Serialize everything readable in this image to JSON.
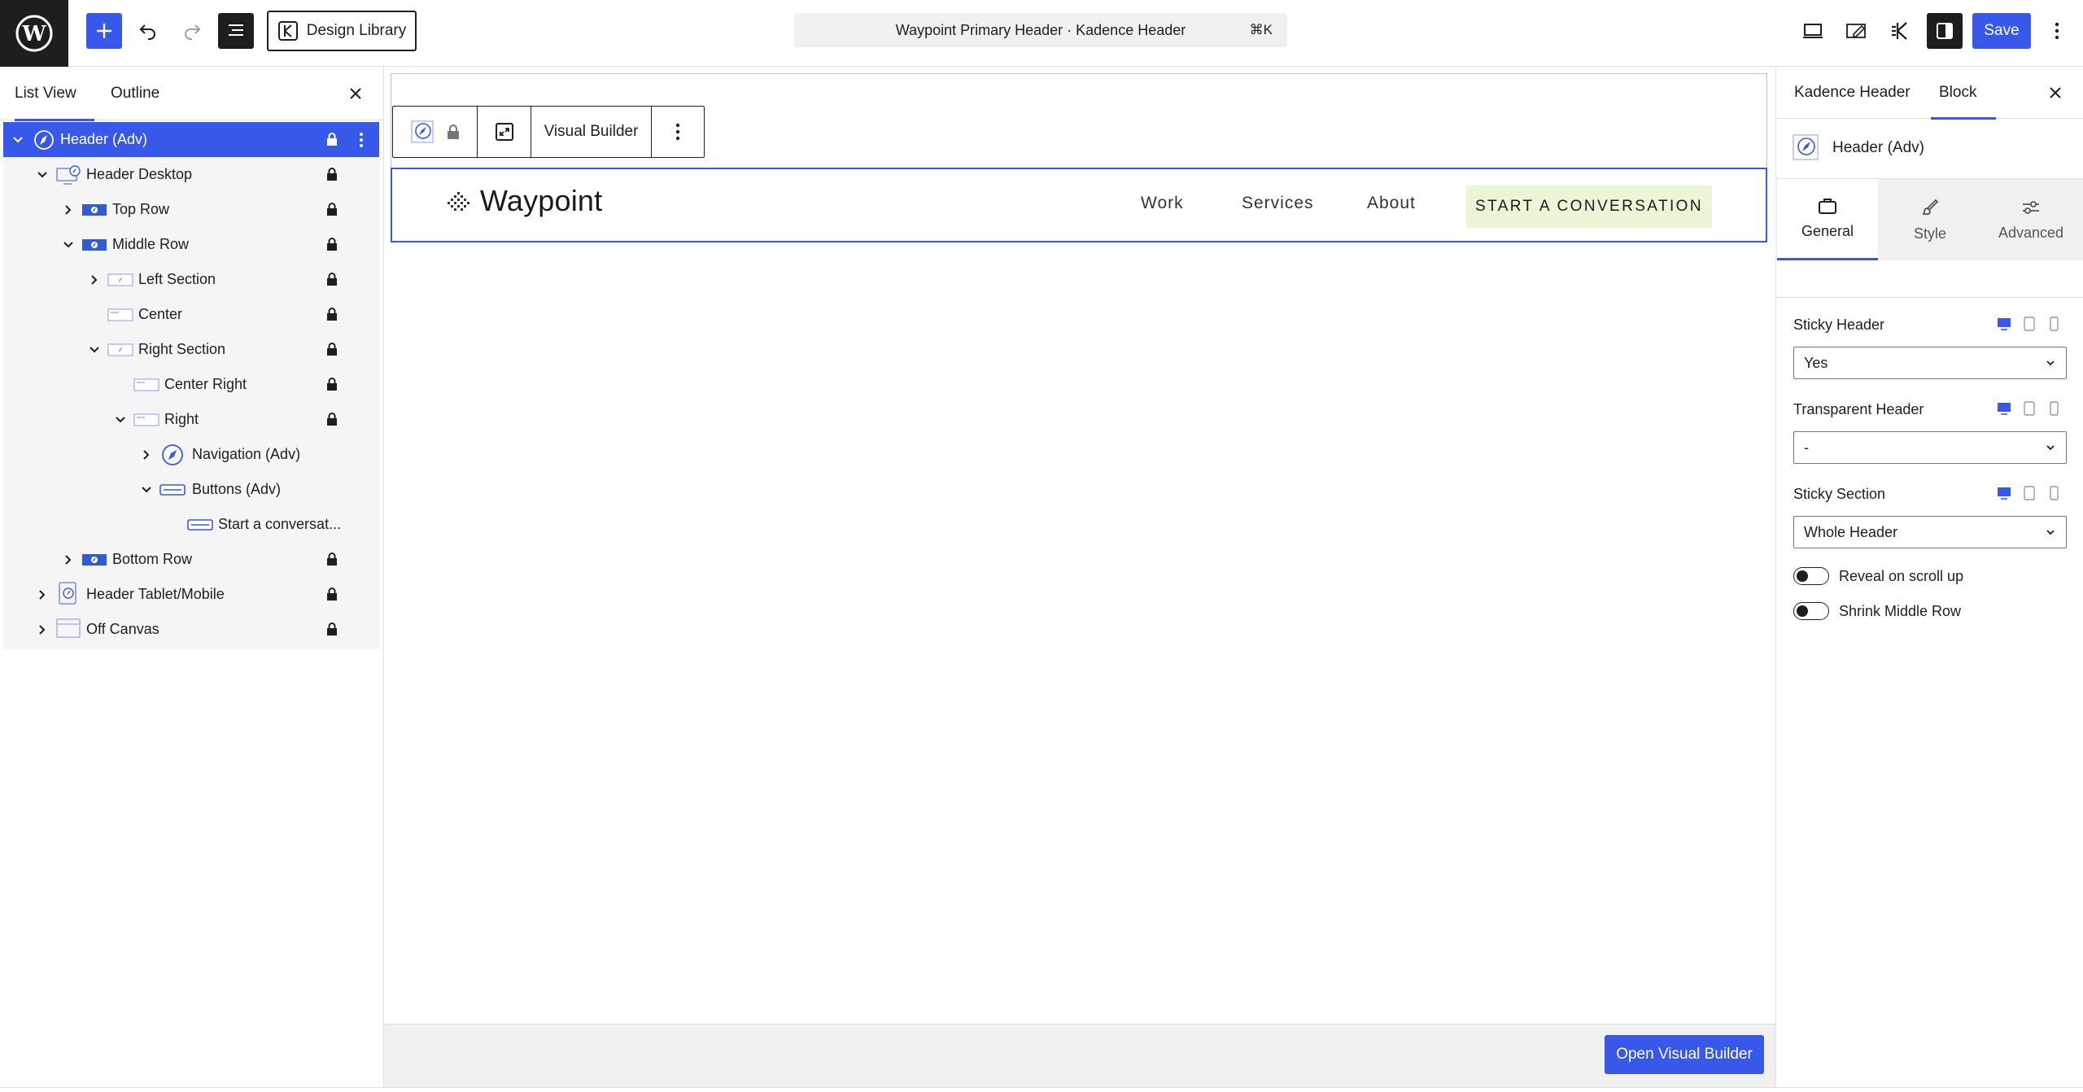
{
  "topbar": {
    "design_library_label": "Design Library",
    "doc_title": "Waypoint Primary Header · Kadence Header",
    "shortcut": "⌘K",
    "save_label": "Save"
  },
  "left_panel": {
    "tabs": [
      {
        "label": "List View"
      },
      {
        "label": "Outline"
      }
    ],
    "tree": [
      {
        "label": "Header (Adv)"
      },
      {
        "label": "Header Desktop"
      },
      {
        "label": "Top Row"
      },
      {
        "label": "Middle Row"
      },
      {
        "label": "Left Section"
      },
      {
        "label": "Center"
      },
      {
        "label": "Right Section"
      },
      {
        "label": "Center Right"
      },
      {
        "label": "Right"
      },
      {
        "label": "Navigation (Adv)"
      },
      {
        "label": "Buttons (Adv)"
      },
      {
        "label": "Start a conversat..."
      },
      {
        "label": "Bottom Row"
      },
      {
        "label": "Header Tablet/Mobile"
      },
      {
        "label": "Off Canvas"
      }
    ]
  },
  "canvas": {
    "toolbar_visual_builder": "Visual Builder",
    "site_name": "Waypoint",
    "nav": [
      "Work",
      "Services",
      "About"
    ],
    "cta": "START A CONVERSATION",
    "open_visual_builder": "Open Visual Builder"
  },
  "right_panel": {
    "tabs": [
      {
        "label": "Kadence Header"
      },
      {
        "label": "Block"
      }
    ],
    "block_name": "Header (Adv)",
    "subtabs": [
      {
        "label": "General"
      },
      {
        "label": "Style"
      },
      {
        "label": "Advanced"
      }
    ],
    "fields": {
      "sticky_header": {
        "label": "Sticky Header",
        "value": "Yes"
      },
      "transparent_header": {
        "label": "Transparent Header",
        "value": "-"
      },
      "sticky_section": {
        "label": "Sticky Section",
        "value": "Whole Header"
      }
    },
    "toggles": [
      {
        "label": "Reveal on scroll up",
        "on": false
      },
      {
        "label": "Shrink Middle Row",
        "on": false
      }
    ]
  },
  "colors": {
    "accent": "#3858e9",
    "cta_bg": "#eaf6d6",
    "dark": "#1e1e1e"
  }
}
